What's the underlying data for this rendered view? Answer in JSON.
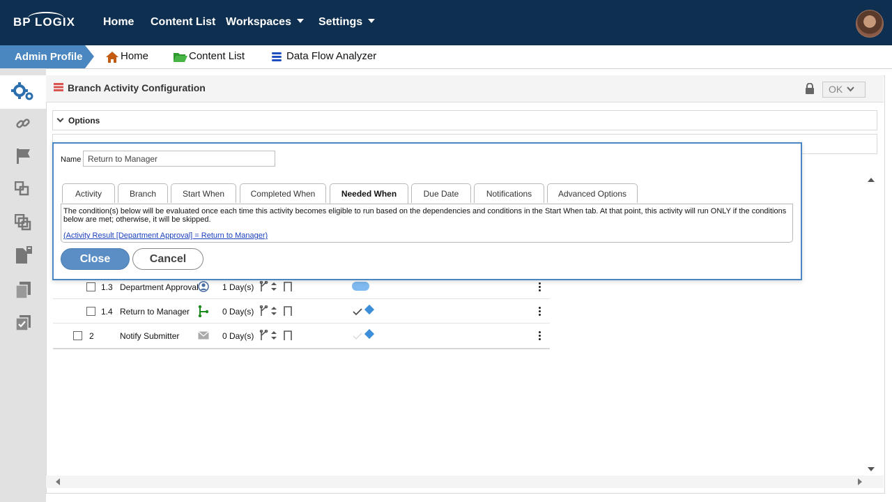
{
  "brand": {
    "logo_text": "BP LOGIX"
  },
  "topnav": {
    "items": [
      {
        "label": "Home"
      },
      {
        "label": "Content List"
      },
      {
        "label": "Workspaces"
      },
      {
        "label": "Settings"
      }
    ]
  },
  "breadcrumb": {
    "profile": "Admin Profile",
    "items": [
      {
        "label": "Home",
        "icon": "house-icon"
      },
      {
        "label": "Content List",
        "icon": "folder-open-icon"
      },
      {
        "label": "Data Flow Analyzer",
        "icon": "database-icon"
      }
    ]
  },
  "panel": {
    "title": "Branch Activity Configuration",
    "ok_label": "OK",
    "options_label": "Options"
  },
  "dialog": {
    "name_label": "Name",
    "name_value": "Return to Manager",
    "tabs": [
      {
        "label": "Activity"
      },
      {
        "label": "Branch"
      },
      {
        "label": "Start When"
      },
      {
        "label": "Completed When"
      },
      {
        "label": "Needed When"
      },
      {
        "label": "Due Date"
      },
      {
        "label": "Notifications"
      },
      {
        "label": "Advanced Options"
      }
    ],
    "active_tab": "Needed When",
    "description": "The condition(s) below will be evaluated once each time this activity becomes eligible to run based on the dependencies and conditions in the Start When tab. At that point, this activity will run ONLY if the conditions below are met; otherwise, it will be skipped.",
    "condition_link": "(Activity Result [Department Approval] = Return to Manager)",
    "close_label": "Close",
    "cancel_label": "Cancel"
  },
  "table": {
    "rows": [
      {
        "num": "1.3",
        "name": "Department Approval",
        "type_icon": "user-icon",
        "duration": "1 Day(s)",
        "status": "pill"
      },
      {
        "num": "1.4",
        "name": "Return to Manager",
        "type_icon": "branch-icon",
        "duration": "0 Day(s)",
        "status": "check-diamond"
      },
      {
        "num": "2",
        "name": "Notify Submitter",
        "type_icon": "envelope-icon",
        "duration": "0 Day(s)",
        "status": "check-diamond"
      }
    ]
  },
  "colors": {
    "topbar": "#0e2f4f",
    "accent": "#4a86c0",
    "close_button": "#5b8ec4",
    "status_blue": "#3d8ed8",
    "breadcrumb_home_icon": "#c45a10",
    "breadcrumb_folder_icon": "#2e9a2e",
    "breadcrumb_db_icon": "#1f4fbf"
  }
}
